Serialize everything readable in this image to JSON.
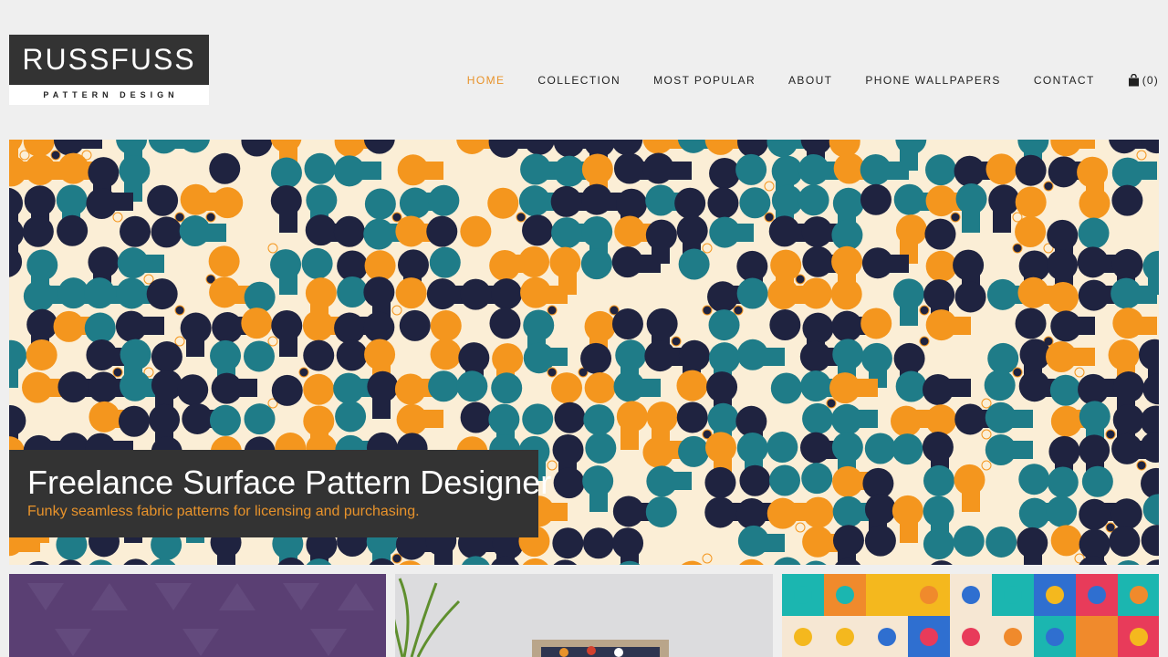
{
  "logo": {
    "title": "RUSSFUSS",
    "subtitle": "PATTERN DESIGN"
  },
  "nav": {
    "items": [
      {
        "label": "HOME",
        "active": true
      },
      {
        "label": "COLLECTION",
        "active": false
      },
      {
        "label": "MOST POPULAR",
        "active": false
      },
      {
        "label": "ABOUT",
        "active": false
      },
      {
        "label": "PHONE WALLPAPERS",
        "active": false
      },
      {
        "label": "CONTACT",
        "active": false
      }
    ],
    "cart_label": "(0)",
    "cart_icon": "shopping-bag-icon"
  },
  "hero": {
    "title": "Freelance Surface Pattern Designer",
    "subtitle": "Funky seamless fabric patterns for licensing and purchasing."
  },
  "thumbnails": [
    {
      "name": "purple-geometric-pattern"
    },
    {
      "name": "patterned-cushion-with-plant"
    },
    {
      "name": "colorful-drop-pattern"
    }
  ],
  "colors": {
    "accent": "#e8932b",
    "dark": "#333333",
    "background": "#efefef",
    "pattern_navy": "#1f2340",
    "pattern_teal": "#1f7c88",
    "pattern_orange": "#f4961e",
    "pattern_cream": "#fbeed6"
  }
}
